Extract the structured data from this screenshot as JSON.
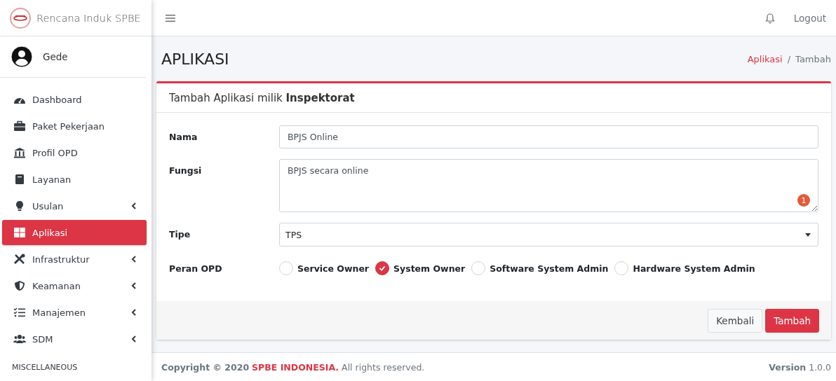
{
  "sidebar": {
    "brand": "Rencana Induk SPBE",
    "user": "Gede",
    "items": [
      {
        "label": "Dashboard",
        "selected": false,
        "expandable": false
      },
      {
        "label": "Paket Pekerjaan",
        "selected": false,
        "expandable": false
      },
      {
        "label": "Profil OPD",
        "selected": false,
        "expandable": false
      },
      {
        "label": "Layanan",
        "selected": false,
        "expandable": false
      },
      {
        "label": "Usulan",
        "selected": false,
        "expandable": true
      },
      {
        "label": "Aplikasi",
        "selected": true,
        "expandable": false
      },
      {
        "label": "Infrastruktur",
        "selected": false,
        "expandable": true
      },
      {
        "label": "Keamanan",
        "selected": false,
        "expandable": true
      },
      {
        "label": "Manajemen",
        "selected": false,
        "expandable": true
      },
      {
        "label": "SDM",
        "selected": false,
        "expandable": true
      }
    ],
    "section": "MISCELLANEOUS"
  },
  "topbar": {
    "logout": "Logout"
  },
  "page": {
    "title": "APLIKASI",
    "separator": "/",
    "breadcrumb": [
      {
        "label": "Aplikasi",
        "link": true
      },
      {
        "label": "Tambah",
        "link": false
      }
    ]
  },
  "card": {
    "title": "Tambah Aplikasi milik **Inspektorat**",
    "fields": [
      {
        "kind": "input",
        "label": "Nama",
        "value": "BPJS Online"
      },
      {
        "kind": "textarea",
        "label": "Fungsi",
        "value": "BPJS secara online",
        "badge": "1"
      },
      {
        "kind": "select",
        "label": "Tipe",
        "value": "TPS"
      },
      {
        "kind": "checks",
        "label": "Peran OPD",
        "options": [
          {
            "label": "Service Owner",
            "checked": false
          },
          {
            "label": "System Owner",
            "checked": true
          },
          {
            "label": "Software System Admin",
            "checked": false
          },
          {
            "label": "Hardware System Admin",
            "checked": false
          }
        ]
      }
    ],
    "buttons": [
      {
        "label": "Kembali",
        "kind": "secondary"
      },
      {
        "label": "Tambah",
        "kind": "primary"
      }
    ]
  },
  "footer": {
    "lead": "Copyright © 2020",
    "brand": "SPBE INDONESIA.",
    "rest": "All rights reserved.",
    "version": "**Version** 1.0.0"
  }
}
